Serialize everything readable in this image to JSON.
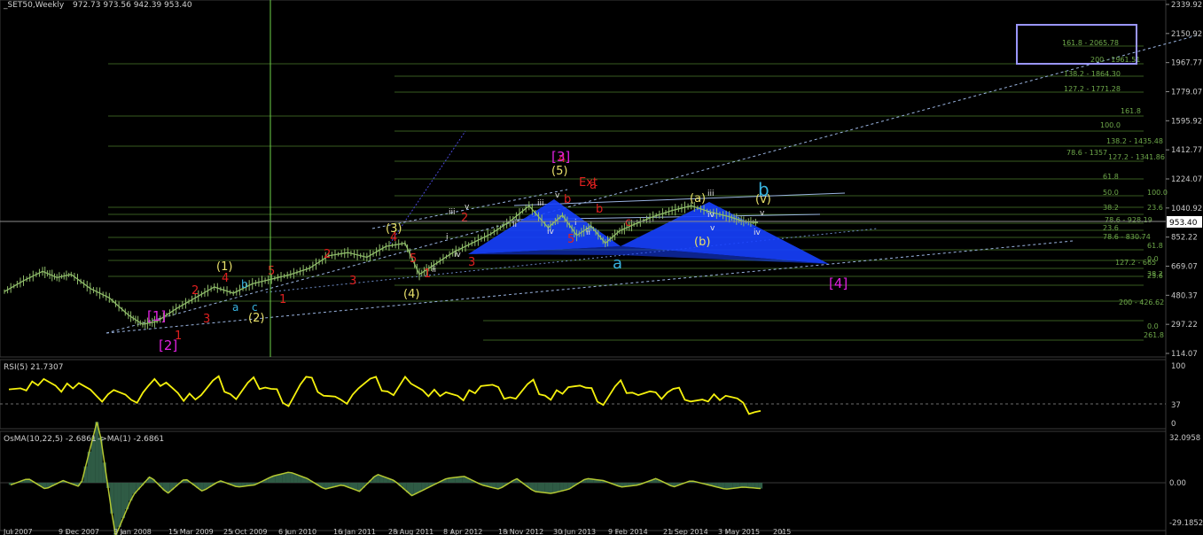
{
  "header": {
    "symbol": "_SET50,Weekly",
    "ohlc": "972.73 973.56 942.39 953.40"
  },
  "current_price": "953.40",
  "colors": {
    "background": "#000000",
    "price_bars": "#8fbc6a",
    "grid": "#4a7d2c",
    "fib_text": "#6ea84a",
    "triangle_fill": "#1640ff",
    "rsi_line": "#f5f10d",
    "osma_fill": "#2f5b45",
    "osma_line": "#b4c832",
    "wave_red": "#e02020",
    "wave_magenta": "#e020e0",
    "wave_yellow": "#e8e06a",
    "wave_cyan": "#38b4e0",
    "target_box": "#9a96ff"
  },
  "chart_data": [
    {
      "type": "line",
      "title": "_SET50,Weekly",
      "ohlc_label": "972.73 973.56 942.39 953.40",
      "ylim": [
        114.07,
        2350
      ],
      "y_ticks": [
        "2339.92",
        "2150.92",
        "1967.77",
        "1779.07",
        "1595.92",
        "1412.77",
        "1224.07",
        "1040.92",
        "852.22",
        "669.07",
        "480.37",
        "297.22",
        "114.07"
      ],
      "x_tick_labels": [
        "Jul 2007",
        "9 Dec 2007",
        "3 Jan 2008",
        "15 Mar 2009",
        "25 Oct 2009",
        "6 Jun 2010",
        "16 Jan 2011",
        "28 Aug 2011",
        "8 Apr 2012",
        "18 Nov 2012",
        "30 Jun 2013",
        "9 Feb 2014",
        "21 Sep 2014",
        "3 May 2015",
        "2015"
      ],
      "series": [
        {
          "x": [
            2007.4,
            2007.6,
            2007.8,
            2007.95,
            2008.1,
            2008.3,
            2008.5,
            2008.7,
            2008.85,
            2009.0,
            2009.2,
            2009.4,
            2009.6,
            2009.8,
            2010.0,
            2010.2,
            2010.4,
            2010.6,
            2010.8,
            2011.0,
            2011.2,
            2011.4,
            2011.6,
            2011.75,
            2011.9,
            2012.1,
            2012.3,
            2012.5,
            2012.7,
            2012.9,
            2013.1,
            2013.25,
            2013.4,
            2013.55,
            2013.7,
            2013.85,
            2014.0,
            2014.2,
            2014.4,
            2014.6,
            2014.8,
            2015.0,
            2015.15,
            2015.3
          ],
          "values": [
            510,
            580,
            640,
            600,
            620,
            530,
            470,
            360,
            300,
            320,
            400,
            470,
            540,
            500,
            560,
            590,
            620,
            660,
            740,
            760,
            730,
            800,
            820,
            620,
            680,
            760,
            820,
            880,
            960,
            1060,
            920,
            1000,
            870,
            930,
            820,
            900,
            940,
            990,
            1030,
            1060,
            1020,
            990,
            960,
            953
          ]
        }
      ],
      "fibonacci_labels": [
        "161.8 - 2065.78",
        "200 - 1961.51",
        "138.2 - 1864.30",
        "127.2 - 1771.28",
        "161.8",
        "100.0",
        "138.2 - 1435.48",
        "78.6 - 1357",
        "127.2 - 1341.86",
        "61.8",
        "50.0",
        "100.0",
        "38.2",
        "23.6",
        "78.6 - 928.19",
        "23.6",
        "78.6 - 830.74",
        "61.8",
        "0.0",
        "127.2 - 665",
        "23.6",
        "38.2",
        "200 - 426.62",
        "0.0",
        "261.8"
      ],
      "wave_labels": {
        "red": [
          "1",
          "2",
          "3",
          "4",
          "5",
          "1",
          "2",
          "3",
          "4",
          "5",
          "1",
          "2",
          "3",
          "4",
          "5",
          "Ext",
          "a",
          "b",
          "c",
          "b"
        ],
        "magenta": [
          "[1]",
          "[2]",
          "[3]",
          "[4]"
        ],
        "yellow": [
          "(1)",
          "(2)",
          "(3)",
          "(4)",
          "(5)",
          "(a)",
          "(b)",
          "(v)"
        ],
        "cyan": [
          "a",
          "b",
          "c",
          "a",
          "b"
        ],
        "small": [
          "i",
          "ii",
          "iii",
          "iv",
          "v",
          "ii",
          "iii",
          "iv",
          "v",
          "i",
          "ii",
          "iv",
          "v",
          "iii",
          "iv",
          "v"
        ]
      }
    },
    {
      "type": "line",
      "title": "RSI(5) 21.7307",
      "ylim": [
        0,
        100
      ],
      "y_ticks": [
        "100",
        "37",
        "0"
      ],
      "level_line": 37,
      "series": [
        {
          "name": "RSI(5)",
          "values": [
            70,
            55,
            85,
            50,
            75,
            40,
            60,
            30,
            65,
            80,
            35,
            55,
            75,
            45,
            70,
            60,
            40,
            78,
            55,
            35,
            65,
            72,
            50,
            80,
            45,
            62,
            35,
            70,
            55,
            45,
            65,
            40,
            72,
            58,
            38,
            68,
            52,
            44,
            60,
            48,
            35,
            55,
            30,
            21.73
          ]
        }
      ]
    },
    {
      "type": "area",
      "title": "OsMA(10,22,5) -2.6861",
      "subtitle": "->MA(1) -2.6861",
      "ylim": [
        -29.1852,
        32.0958
      ],
      "y_ticks": [
        "32.0958",
        "0.00",
        "-29.1852"
      ],
      "series": [
        {
          "name": "OsMA",
          "values": [
            -1,
            2,
            -3,
            1,
            -2,
            30,
            -25,
            -6,
            3,
            -5,
            2,
            -4,
            1,
            -2,
            -1,
            3,
            5,
            2,
            -3,
            -1,
            -4,
            4,
            1,
            -6,
            -2,
            2,
            3,
            -1,
            -3,
            2,
            -4,
            -5,
            -3,
            2,
            1,
            -2,
            -1,
            2,
            -2,
            1,
            -1,
            -3,
            -2,
            -2.69
          ]
        }
      ]
    }
  ]
}
